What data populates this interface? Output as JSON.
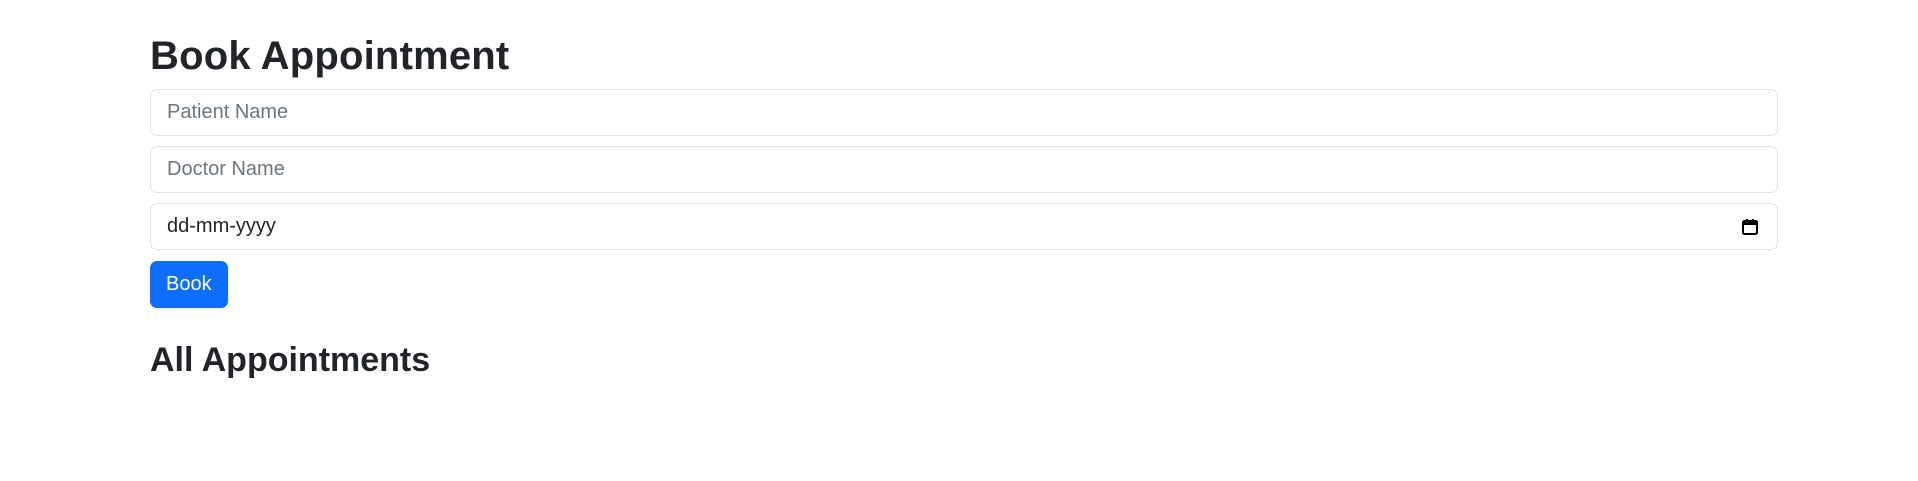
{
  "form": {
    "title": "Book Appointment",
    "patient_name_placeholder": "Patient Name",
    "doctor_name_placeholder": "Doctor Name",
    "date_value": "dd-mm-yyyy",
    "date_icon": "calendar-icon",
    "book_label": "Book"
  },
  "list": {
    "title": "All Appointments",
    "items": []
  },
  "colors": {
    "primary": "#0d6efd",
    "text": "#212529",
    "placeholder": "#6c757d",
    "border": "#dee2e6"
  }
}
